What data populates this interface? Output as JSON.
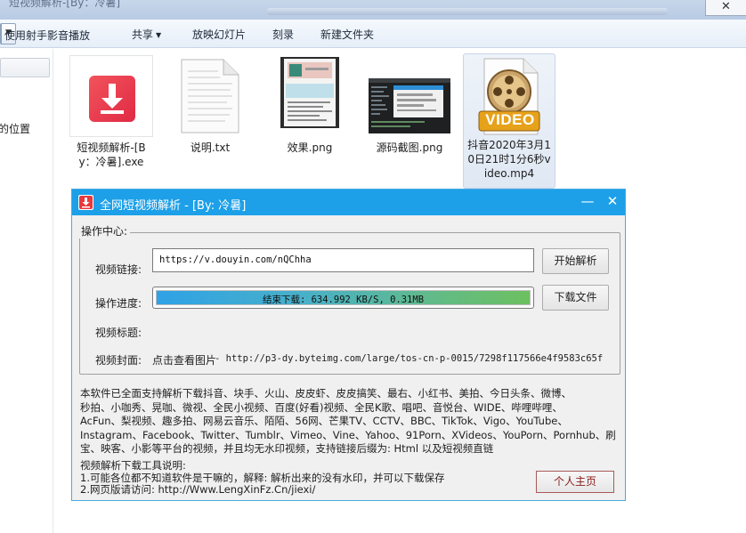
{
  "explorer": {
    "window_title": "短视频解析-[By：冷暑]",
    "close_glyph": "✕",
    "toolbar": {
      "play_with": "使用射手影音播放",
      "share": "共享",
      "slideshow": "放映幻灯片",
      "burn": "刻录",
      "new_folder": "新建文件夹"
    },
    "nav_location_label": "的位置",
    "files": [
      {
        "name": "短视频解析-[By：冷暑].exe",
        "icon": "download-app-icon"
      },
      {
        "name": "说明.txt",
        "icon": "text-file-icon"
      },
      {
        "name": "效果.png",
        "icon": "image-thumbnail"
      },
      {
        "name": "源码截图.png",
        "icon": "image-thumbnail"
      },
      {
        "name": "抖音2020年3月10日21时1分6秒video.mp4",
        "icon": "video-reel-icon",
        "badge": "VIDEO",
        "selected": true
      }
    ]
  },
  "app": {
    "title": "全网短视频解析 - [By: 冷暑]",
    "minimize_glyph": "—",
    "close_glyph": "✕",
    "group_title": "操作中心:",
    "link_label": "视频链接:",
    "link_value": "https://v.douyin.com/nQChha",
    "parse_button": "开始解析",
    "progress_label": "操作进度:",
    "progress_text": "结束下载: 634.992 KB/S, 0.31MB",
    "progress_value": 1.0,
    "download_button": "下载文件",
    "title_label": "视频标题:",
    "title_value": "",
    "cover_label": "视频封面:",
    "cover_link_text": "点击查看图片",
    "cover_url": " - http://p3-dy.byteimg.com/large/tos-cn-p-0015/7298f117566e4f9583c65f",
    "description_lines": [
      "本软件已全面支持解析下载抖音、块手、火山、皮皮虾、皮皮搞笑、最右、小红书、美拍、今日头条、微博、",
      "秒拍、小咖秀、晃咖、微视、全民小视频、百度(好看)视频、全民K歌、唱吧、音悦台、WIDE、哔哩哔哩、",
      "AcFun、梨视频、趣多拍、网易云音乐、陌陌、56网、芒果TV、CCTV、BBC、TikTok、Vigo、YouTube、",
      "Instagram、Facebook、Twitter、Tumblr、Vimeo、Vine、Yahoo、91Porn、XVideos、YouPorn、Pornhub、刷",
      "宝、映客、小影等平台的视频，并且均无水印视频，支持链接后缀为: Html 以及短视频直链"
    ],
    "help_lines": [
      "视频解析下载工具说明:",
      "1.可能各位都不知道软件是干嘛的，解释: 解析出来的没有水印，并可以下载保存",
      "2.网页版请访问: http://Www.LengXinFz.Cn/jiexi/"
    ],
    "home_button": "个人主页",
    "colors": {
      "titlebar": "#1da0e8",
      "progress_start": "#2fa2e6",
      "progress_end": "#6cc060",
      "home_button_text": "#8b1a1a"
    }
  }
}
